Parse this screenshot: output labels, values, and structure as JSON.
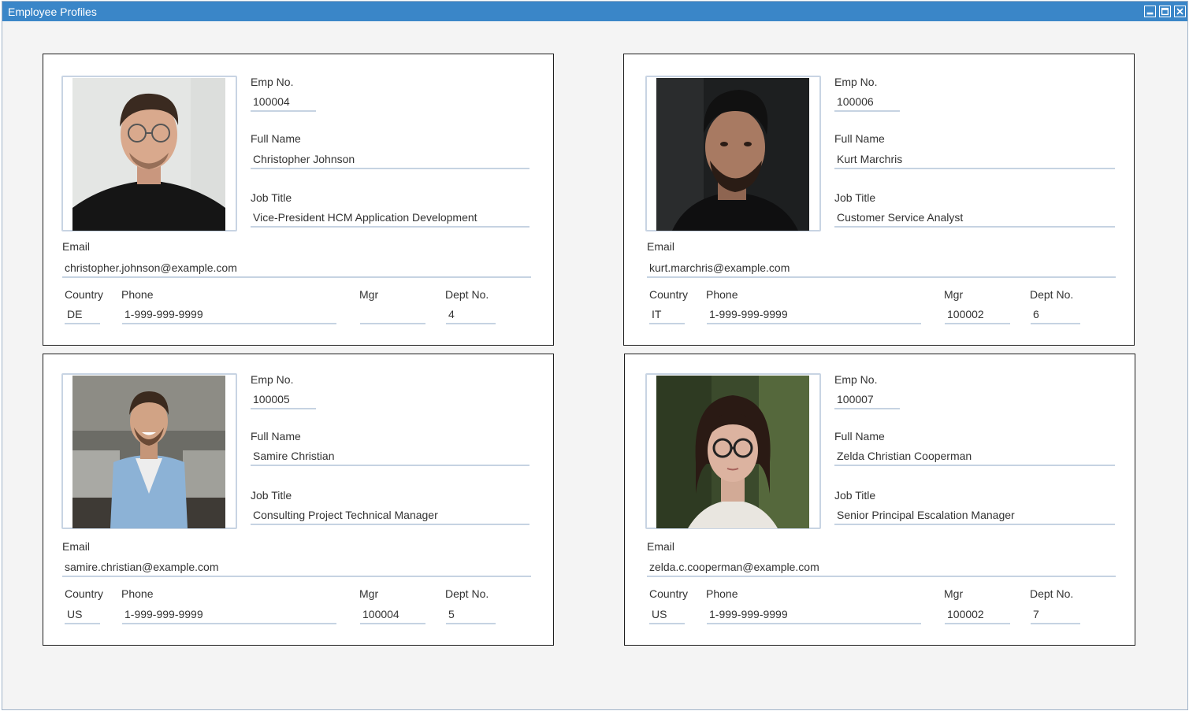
{
  "window": {
    "title": "Employee Profiles",
    "title_bar_color": "#3a86c8"
  },
  "labels": {
    "emp_no": "Emp No.",
    "full_name": "Full Name",
    "job_title": "Job Title",
    "email": "Email",
    "country": "Country",
    "phone": "Phone",
    "mgr": "Mgr",
    "dept_no": "Dept No."
  },
  "employees": [
    {
      "emp_no": "100004",
      "full_name": "Christopher Johnson",
      "job_title": "Vice-President HCM Application Development",
      "email": "christopher.johnson@example.com",
      "country": "DE",
      "phone": "1-999-999-9999",
      "mgr": "",
      "dept_no": "4",
      "photo": "man-with-glasses-portrait"
    },
    {
      "emp_no": "100006",
      "full_name": "Kurt Marchris",
      "job_title": "Customer Service Analyst",
      "email": "kurt.marchris@example.com",
      "country": "IT",
      "phone": "1-999-999-9999",
      "mgr": "100002",
      "dept_no": "6",
      "photo": "bearded-man-portrait"
    },
    {
      "emp_no": "100005",
      "full_name": "Samire Christian",
      "job_title": "Consulting Project Technical Manager",
      "email": "samire.christian@example.com",
      "country": "US",
      "phone": "1-999-999-9999",
      "mgr": "100004",
      "dept_no": "5",
      "photo": "smiling-man-in-office-portrait"
    },
    {
      "emp_no": "100007",
      "full_name": "Zelda Christian Cooperman",
      "job_title": "Senior Principal Escalation Manager",
      "email": "zelda.c.cooperman@example.com",
      "country": "US",
      "phone": "1-999-999-9999",
      "mgr": "100002",
      "dept_no": "7",
      "photo": "woman-with-glasses-portrait"
    }
  ]
}
